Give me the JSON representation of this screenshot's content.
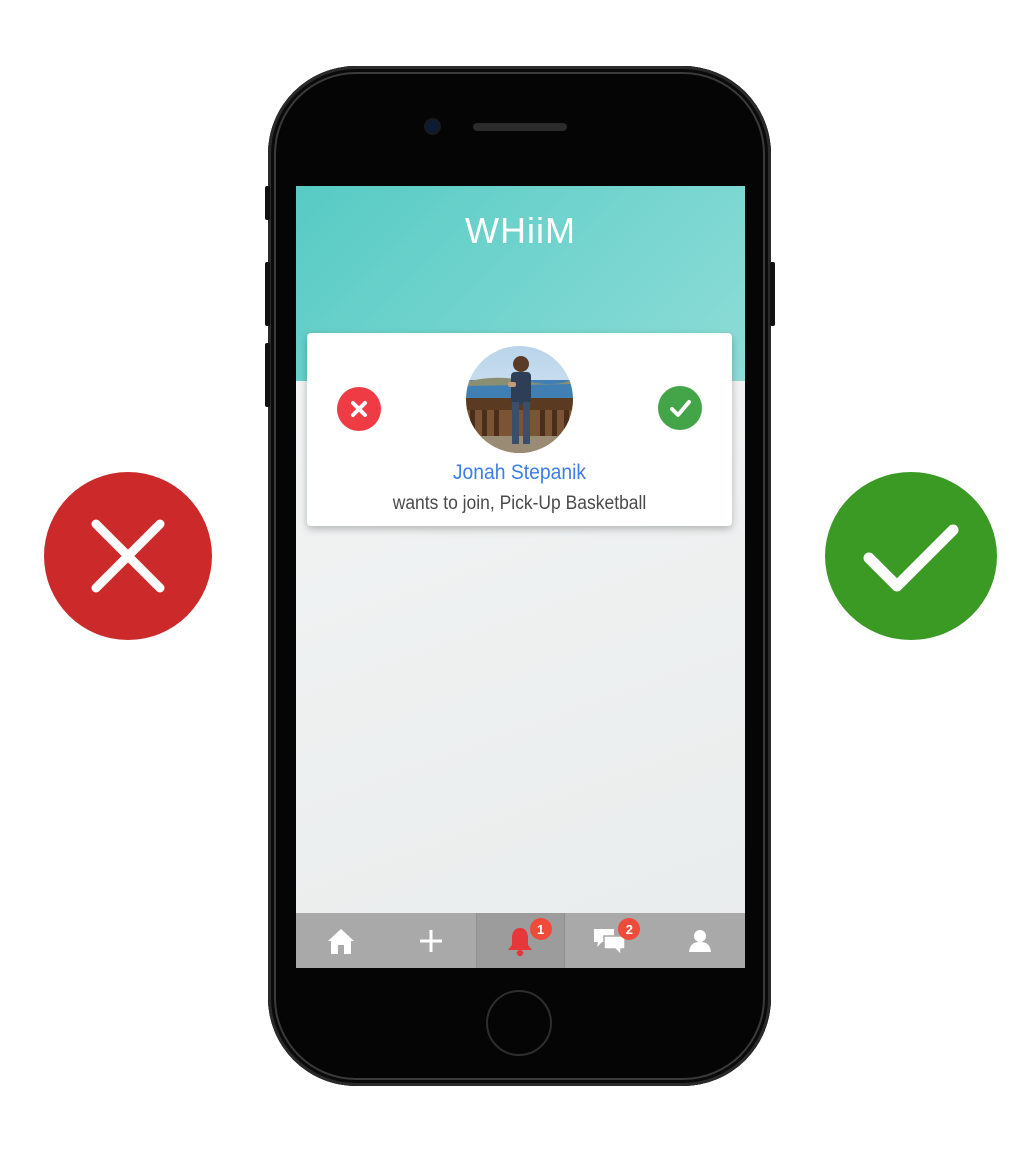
{
  "app": {
    "title": "WHiiM"
  },
  "request": {
    "name": "Jonah Stepanik",
    "message": "wants to join, Pick-Up Basketball"
  },
  "nav": {
    "items": [
      {
        "icon": "home-icon"
      },
      {
        "icon": "plus-icon"
      },
      {
        "icon": "bell-icon",
        "badge": "1",
        "active": true
      },
      {
        "icon": "chat-icon",
        "badge": "2"
      },
      {
        "icon": "profile-icon"
      }
    ]
  },
  "colors": {
    "reject": "#cc2a2a",
    "accept": "#3a9a24",
    "header": "#57cbc4",
    "name": "#3d7ee6",
    "badge": "#f04a3a"
  }
}
